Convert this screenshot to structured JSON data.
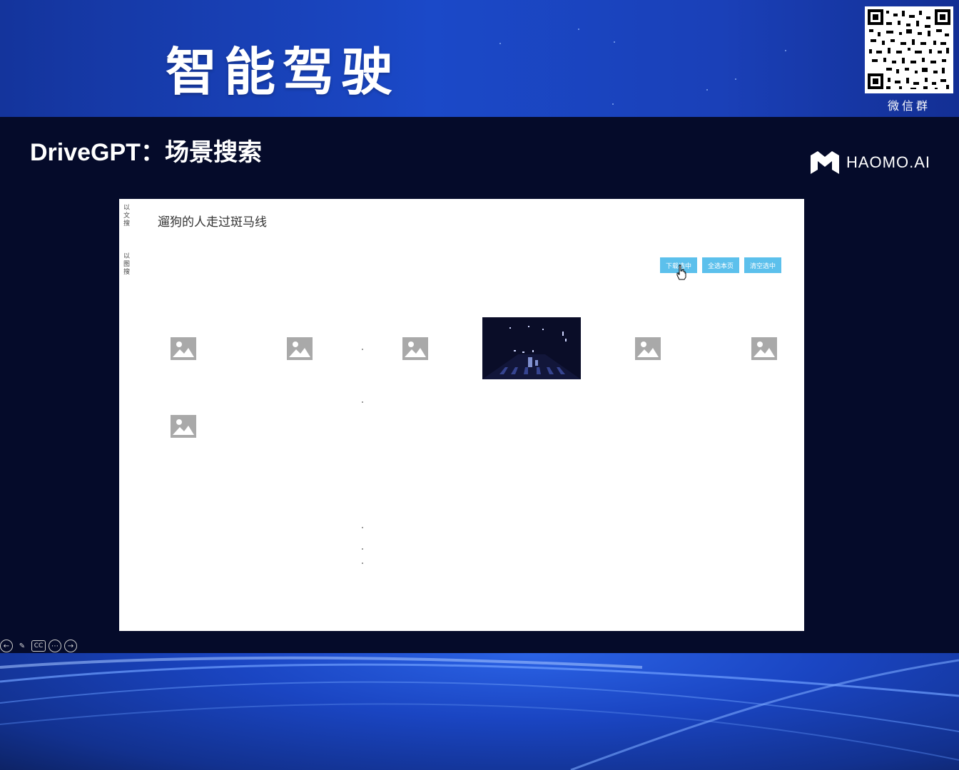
{
  "header": {
    "title": "智能驾驶",
    "qr_label": "微信群"
  },
  "slide": {
    "title": "DriveGPT：场景搜索",
    "logo_text": "HAOMO.AI"
  },
  "app": {
    "side_tabs": [
      "以文搜",
      "以图搜"
    ],
    "query": "遛狗的人走过斑马线",
    "buttons": [
      "下载选中",
      "全选本页",
      "清空选中"
    ],
    "results": [
      {
        "type": "placeholder",
        "icon": "image-placeholder-icon"
      },
      {
        "type": "placeholder",
        "icon": "image-placeholder-icon"
      },
      {
        "type": "placeholder",
        "icon": "image-placeholder-icon"
      },
      {
        "type": "scene-thumbnail",
        "icon": "night-crosswalk-scene"
      },
      {
        "type": "placeholder",
        "icon": "image-placeholder-icon"
      },
      {
        "type": "placeholder",
        "icon": "image-placeholder-icon"
      },
      {
        "type": "placeholder",
        "icon": "image-placeholder-icon"
      }
    ],
    "accent_color": "#5cc0ec"
  },
  "toolbar": {
    "icons": [
      "back-arrow-icon",
      "pen-icon",
      "cc-icon",
      "more-icon",
      "forward-arrow-icon"
    ],
    "cc_label": "CC"
  }
}
